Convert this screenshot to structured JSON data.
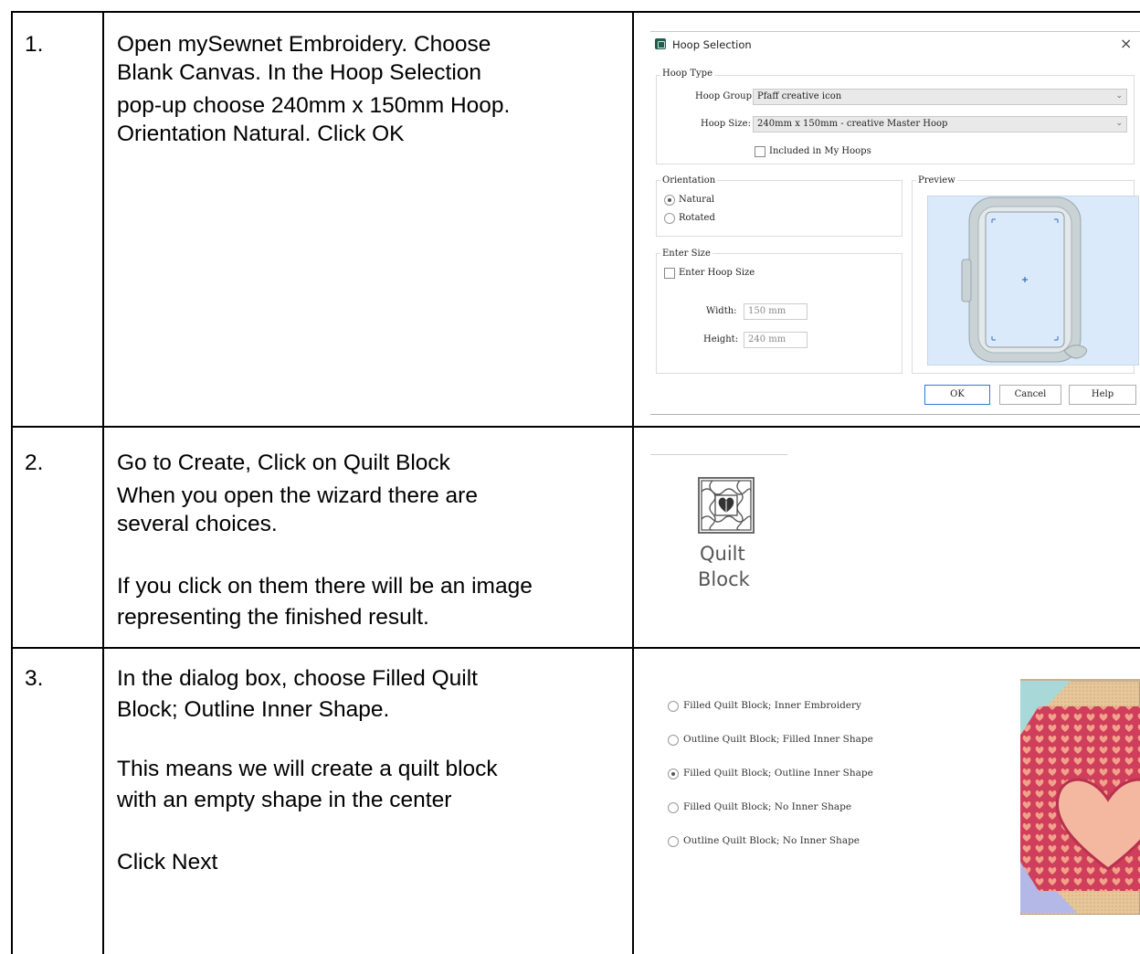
{
  "rows": [
    {
      "num": "1.",
      "lines": [
        "Open mySewnet Embroidery. Choose",
        "Blank Canvas. In the Hoop Selection",
        "pop-up choose 240mm x 150mm Hoop.",
        "Orientation Natural. Click OK"
      ]
    },
    {
      "num": "2.",
      "lines": [
        "Go to Create, Click on Quilt Block",
        "When you open the wizard there are",
        "several choices.",
        "",
        "If you click on them there will be an image",
        "representing the finished result."
      ]
    },
    {
      "num": "3.",
      "lines": [
        "In the dialog box, choose Filled Quilt",
        "Block; Outline Inner Shape.",
        "",
        "This means we will create a quilt block",
        "with an empty shape in the center",
        "",
        "Click Next"
      ]
    }
  ],
  "hoop_dialog": {
    "title": "Hoop Selection",
    "close_glyph": "×",
    "hoop_type_legend": "Hoop Type",
    "hoop_group_label": "Hoop Group:",
    "hoop_group_value": "Pfaff creative icon",
    "hoop_size_label": "Hoop Size:",
    "hoop_size_value": "240mm x 150mm - creative Master Hoop",
    "included_label": "Included in My Hoops",
    "included_checked": false,
    "orientation_legend": "Orientation",
    "orientation_options": [
      {
        "label": "Natural",
        "selected": true
      },
      {
        "label": "Rotated",
        "selected": false
      }
    ],
    "enter_size_legend": "Enter Size",
    "enter_hoop_size_label": "Enter Hoop Size",
    "enter_hoop_size_checked": false,
    "width_label": "Width:",
    "width_value": "150 mm",
    "height_label": "Height:",
    "height_value": "240 mm",
    "preview_legend": "Preview",
    "buttons": {
      "ok": "OK",
      "cancel": "Cancel",
      "help": "Help"
    }
  },
  "quilt_block_button": {
    "line1": "Quilt",
    "line2": "Block"
  },
  "quilt_options": [
    {
      "label": "Filled Quilt Block; Inner Embroidery",
      "selected": false
    },
    {
      "label": "Outline Quilt Block; Filled Inner Shape",
      "selected": false
    },
    {
      "label": "Filled Quilt Block; Outline Inner Shape",
      "selected": true
    },
    {
      "label": "Filled Quilt Block; No Inner Shape",
      "selected": false
    },
    {
      "label": "Outline Quilt Block; No Inner Shape",
      "selected": false
    }
  ],
  "colors": {
    "preview_bg": "#dbeafb",
    "hoop_frame": "#c9d2d4",
    "quilt_red": "#cf3b5a",
    "quilt_tan": "#e6c79a",
    "quilt_teal": "#a9d8d8",
    "quilt_lavender": "#b4b8e6",
    "quilt_pink": "#f4b8a0"
  }
}
